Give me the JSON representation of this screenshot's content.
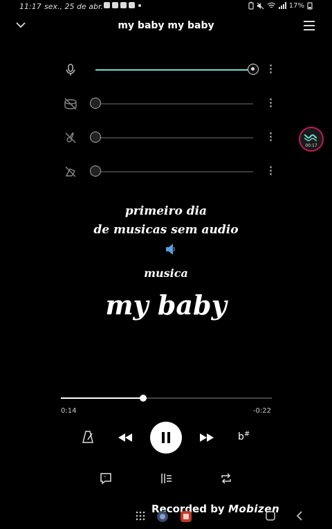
{
  "status_bar": {
    "time": "11:17",
    "date": "sex., 25 de abr.",
    "battery": "17%"
  },
  "header": {
    "title": "my baby my baby"
  },
  "tracks": [
    {
      "icon": "microphone-icon",
      "level": 1.0,
      "active": true
    },
    {
      "icon": "drum-muted-icon",
      "level": 0.0,
      "active": false
    },
    {
      "icon": "bass-guitar-muted-icon",
      "level": 0.0,
      "active": false
    },
    {
      "icon": "instrument-muted-icon",
      "level": 0.0,
      "active": false
    }
  ],
  "record_badge": {
    "time": "00:17"
  },
  "overlay_text": {
    "line1": "primeiro dia",
    "line2": "de musicas sem audio",
    "line3": "musica",
    "line4": "my baby"
  },
  "player": {
    "elapsed": "0:14",
    "remaining": "-0:22",
    "progress": 0.39,
    "key_label": "b#"
  },
  "watermark": {
    "text": "Recorded by",
    "brand": "Mobizen"
  },
  "colors": {
    "accent": "#6fe0d0",
    "badge_ring": "#c2185b"
  }
}
